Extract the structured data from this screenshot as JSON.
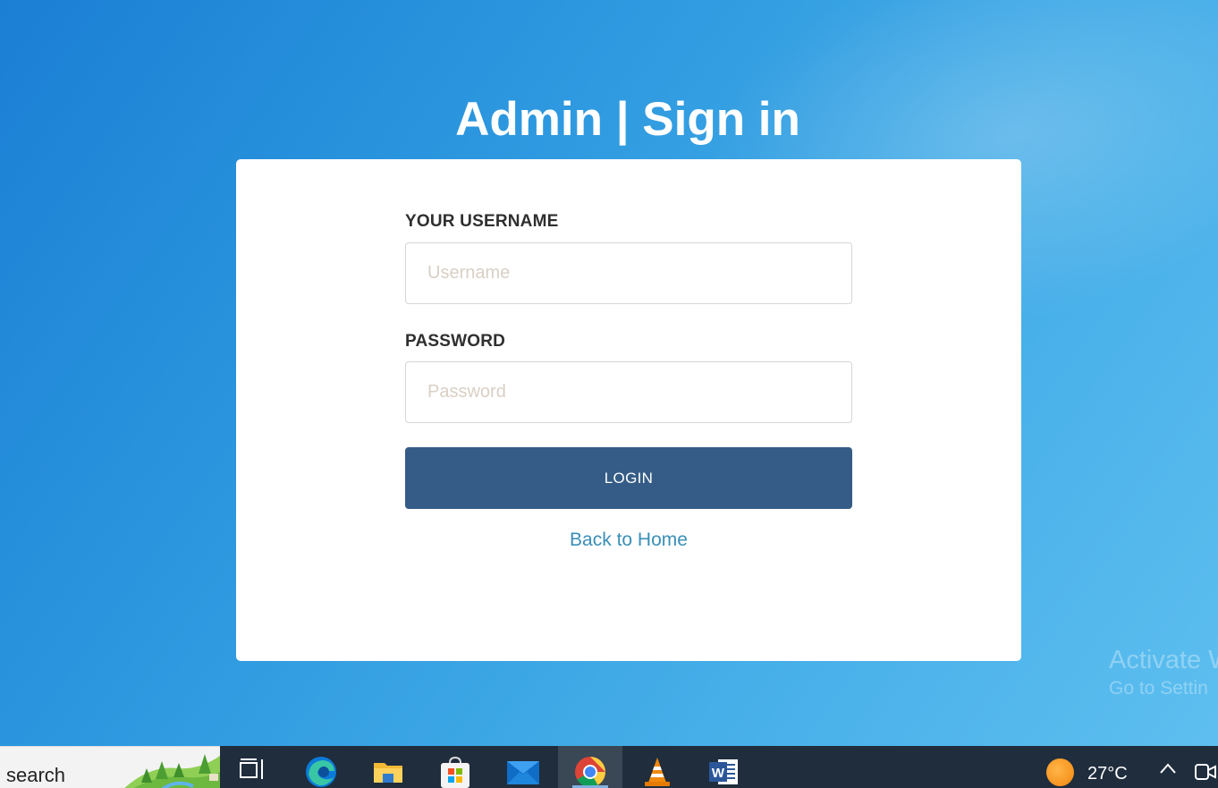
{
  "page": {
    "title": "Admin | Sign in"
  },
  "form": {
    "username_label": "YOUR USERNAME",
    "username_placeholder": "Username",
    "username_value": "",
    "password_label": "PASSWORD",
    "password_placeholder": "Password",
    "password_value": "",
    "login_label": "LOGIN",
    "back_link": "Back to Home"
  },
  "watermark": {
    "line1": "Activate W",
    "line2": "Go to Settin"
  },
  "taskbar": {
    "search_text": "search",
    "apps": [
      {
        "icon": "task-view-icon"
      },
      {
        "icon": "edge-icon"
      },
      {
        "icon": "file-explorer-icon"
      },
      {
        "icon": "microsoft-store-icon"
      },
      {
        "icon": "mail-icon"
      },
      {
        "icon": "chrome-icon",
        "active": true
      },
      {
        "icon": "vlc-icon"
      },
      {
        "icon": "word-icon"
      }
    ],
    "weather_temp": "27°C"
  },
  "colors": {
    "background_start": "#1b7fd4",
    "background_end": "#5fc0f0",
    "card": "#ffffff",
    "login_button": "#345c86",
    "link": "#3a8fb7",
    "taskbar": "#1f2d3d"
  }
}
